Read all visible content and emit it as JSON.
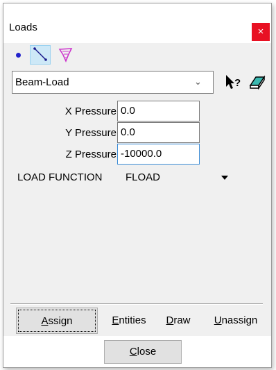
{
  "window": {
    "title": "Loads",
    "close_glyph": "×"
  },
  "toolbar": {
    "icons": [
      "point-icon",
      "line-icon",
      "surface-icon"
    ]
  },
  "entity_type": {
    "value": "Beam-Load",
    "icons": [
      "help-pointer-icon",
      "eraser-icon"
    ]
  },
  "fields": [
    {
      "label": "X Pressure",
      "value": "0.0"
    },
    {
      "label": "Y Pressure",
      "value": "0.0"
    },
    {
      "label": "Z Pressure",
      "value": "-10000.0"
    }
  ],
  "load_function": {
    "label": "LOAD FUNCTION",
    "value": "FLOAD"
  },
  "actions": {
    "assign_mnemonic": "A",
    "assign_rest": "ssign",
    "entities_mnemonic": "E",
    "entities_rest": "ntities",
    "draw_mnemonic": "D",
    "draw_rest": "raw",
    "unassign_mnemonic": "U",
    "unassign_rest": "nassign"
  },
  "footer": {
    "close_mnemonic": "C",
    "close_rest": "lose"
  },
  "colors": {
    "close_x_bg": "#e81123",
    "selected_tool_bg": "#cde8f7",
    "focus_border": "#3c8cd5"
  }
}
